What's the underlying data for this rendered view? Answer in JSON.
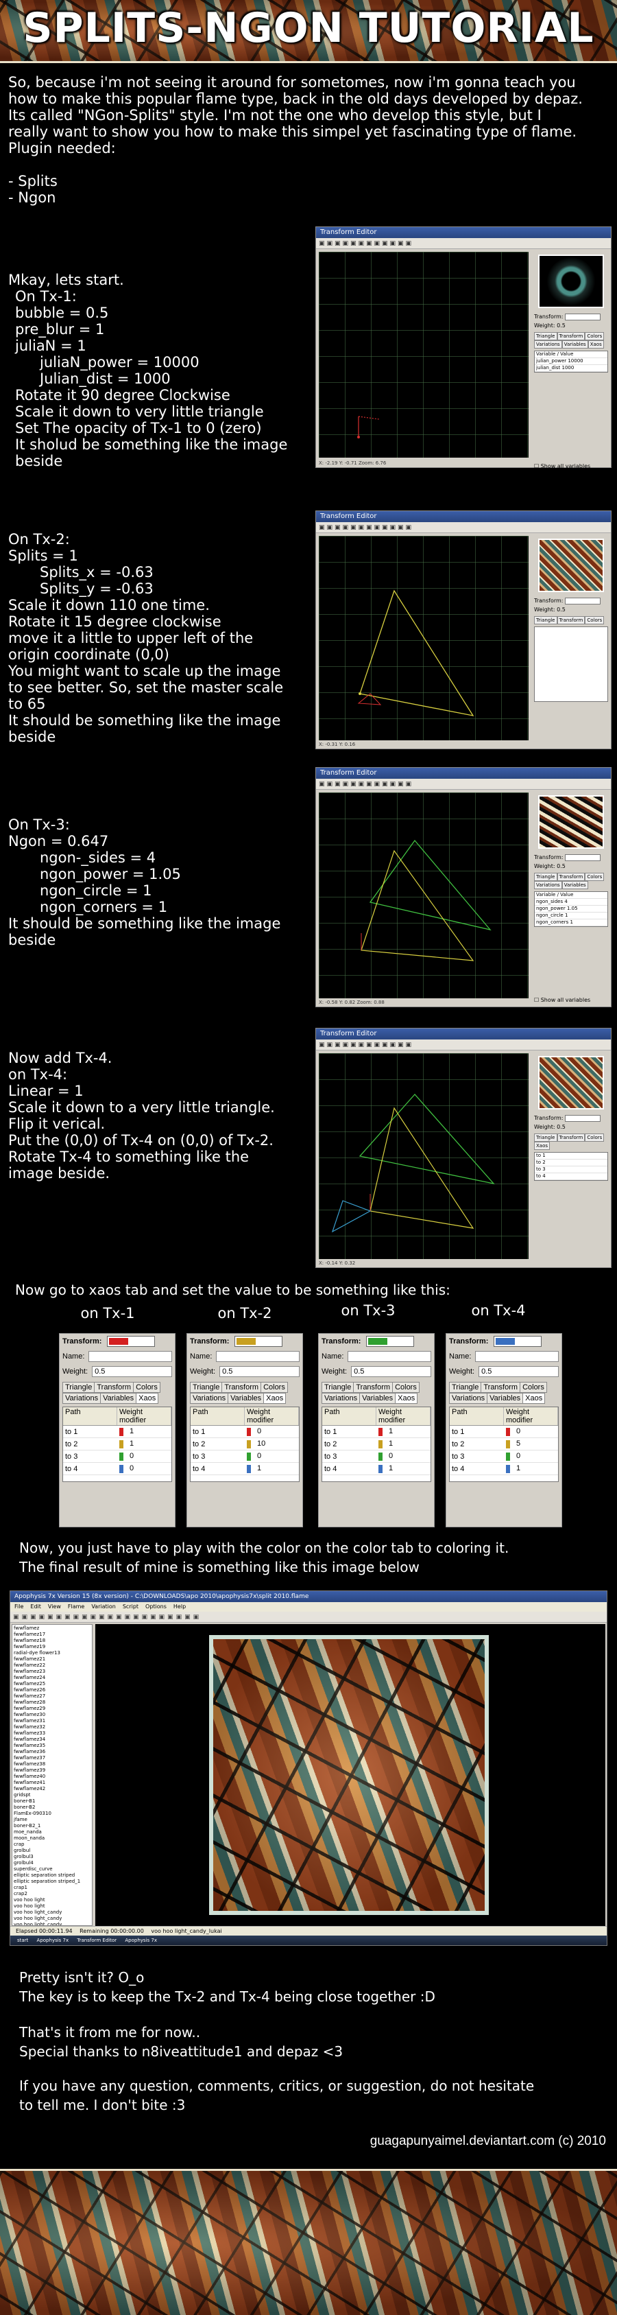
{
  "header": {
    "title": "SPLITS-NGON TUTORIAL"
  },
  "intro": {
    "line1": "So, because i'm not seeing it around for sometomes, now i'm gonna teach you",
    "line2": "how to make this popular flame type, back in the old days developed by depaz.",
    "line3": "Its called \"NGon-Splits\" style. I'm not the one who develop this style, but I",
    "line4": "really want to show you how to make this simpel yet fascinating type of flame.",
    "line5": "Plugin needed:",
    "plugin1": "- Splits",
    "plugin2": "- Ngon"
  },
  "step1": {
    "lines": [
      "Mkay, lets start.",
      "On Tx-1:",
      "bubble = 0.5",
      "pre_blur = 1",
      "juliaN = 1",
      "juliaN_power = 10000",
      "Julian_dist = 1000",
      "Rotate it 90 degree Clockwise",
      "Scale it down to very little triangle",
      "Set The opacity of Tx-1 to 0 (zero)",
      "It sholud be something like the image",
      "beside"
    ]
  },
  "step2": {
    "lines": [
      "On Tx-2:",
      "Splits = 1",
      "Splits_x = -0.63",
      "Splits_y = -0.63",
      "Scale it down 110 one time.",
      "Rotate it 15 degree clockwise",
      "move it a little to upper left of the",
      "origin coordinate (0,0)",
      "You might want to scale up the image",
      "to see better. So, set the master scale",
      "to 65",
      "It should be something like the image",
      "beside"
    ]
  },
  "step3": {
    "lines": [
      "On Tx-3:",
      "Ngon = 0.647",
      "ngon-_sides = 4",
      "ngon_power = 1.05",
      "ngon_circle = 1",
      "ngon_corners = 1",
      "It should be something like the image",
      "beside"
    ]
  },
  "step4": {
    "lines": [
      "Now add Tx-4.",
      "on Tx-4:",
      "Linear = 1",
      "Scale it down to a very little triangle.",
      "Flip it verical.",
      "Put the (0,0) of Tx-4 on (0,0) of Tx-2.",
      "Rotate Tx-4 to something like the",
      "image beside."
    ]
  },
  "editor": {
    "title": "Transform Editor",
    "transform_label": "Transform:",
    "weight_label": "Weight:",
    "weight_value": "0.5",
    "tabs": [
      "Triangle",
      "Transform",
      "Colors",
      "Variations",
      "Variables",
      "Xaos"
    ],
    "var_header": [
      "Variable",
      "Value"
    ],
    "win1_vars": [
      "julian_power  10000",
      "julian_dist  1000"
    ],
    "win3_vars": [
      "ngon_sides  4",
      "ngon_power  1.05",
      "ngon_circle  1",
      "ngon_corners  1"
    ],
    "show_all": "Show all variables",
    "status1": "X: -2.19    Y: -0.71    Zoom: 6.76",
    "status2": "X: -0.31    Y: 0.16",
    "status3": "X: -0.58    Y: 0.82    Zoom: 0.88",
    "status4": "X: -0.14    Y: 0.32"
  },
  "xaos": {
    "intro": "Now go to xaos tab and set the value to be something like this:",
    "transform_label": "Transform:",
    "name_label": "Name:",
    "weight_label": "Weight:",
    "weight_value": "0.5",
    "tabs": [
      "Triangle",
      "Transform",
      "Colors",
      "Variations",
      "Variables",
      "Xaos"
    ],
    "grid_header": [
      "Path",
      "Weight modifier"
    ],
    "panels": [
      {
        "label": "on Tx-1",
        "rows": [
          [
            "to 1",
            "1"
          ],
          [
            "to 2",
            "1"
          ],
          [
            "to 3",
            "0"
          ],
          [
            "to 4",
            "0"
          ]
        ]
      },
      {
        "label": "on Tx-2",
        "rows": [
          [
            "to 1",
            "0"
          ],
          [
            "to 2",
            "10"
          ],
          [
            "to 3",
            "0"
          ],
          [
            "to 4",
            "1"
          ]
        ]
      },
      {
        "label": "on Tx-3",
        "rows": [
          [
            "to 1",
            "1"
          ],
          [
            "to 2",
            "1"
          ],
          [
            "to 3",
            "0"
          ],
          [
            "to 4",
            "1"
          ]
        ]
      },
      {
        "label": "on Tx-4",
        "rows": [
          [
            "to 1",
            "0"
          ],
          [
            "to 2",
            "5"
          ],
          [
            "to 3",
            "0"
          ],
          [
            "to 4",
            "1"
          ]
        ]
      }
    ],
    "swatches": [
      "#d42020",
      "#c8a020",
      "#30a030",
      "#3a70c0"
    ]
  },
  "final": {
    "line1": "Now, you just have to play with the color on the color tab to coloring it.",
    "line2": "The final result of mine is something like this image below"
  },
  "apophysis": {
    "title": "Apophysis 7x Version 15 (8x version) - C:\\DOWNLOADS\\apo 2010\\apophysis7x\\split 2010.flame",
    "menu": [
      "File",
      "Edit",
      "View",
      "Flame",
      "Variation",
      "Script",
      "Options",
      "Help"
    ],
    "list": [
      "fwwflamez",
      "fwwflamez17",
      "fwwflamez18",
      "fwwflamez19",
      "radial-dye flower13",
      "fwwflamez21",
      "fwwflamez22",
      "fwwflamez23",
      "fwwflamez24",
      "fwwflamez25",
      "fwwflamez26",
      "fwwflamez27",
      "fwwflamez28",
      "fwwflamez29",
      "fwwflamez30",
      "fwwflamez31",
      "fwwflamez32",
      "fwwflamez33",
      "fwwflamez34",
      "fwwflamez35",
      "fwwflamez36",
      "fwwflamez37",
      "fwwflamez38",
      "fwwflamez39",
      "fwwflamez40",
      "fwwflamez41",
      "fwwflamez42",
      "gridspt",
      "boner-B1",
      "boner-B2",
      "FlamEx-090310",
      "jfame",
      "boner-B2_1",
      "moe_nanda",
      "moon_nanda",
      "crap",
      "grolbul",
      "grolbul3",
      "grolbul4",
      "superdisc_curve",
      "elliptic separation striped",
      "elliptic separation striped_1",
      "crap1",
      "crap2",
      "voo hoo light",
      "voo hoo light",
      "voo hoo light_candy",
      "voo hoo light_candy",
      "voo hoo light_candy",
      "split 2010"
    ],
    "status": [
      "Elapsed 00:00:11.94",
      "Remaining 00:00:00.00",
      "voo hoo light_candy_lukai"
    ],
    "taskbar": [
      "start",
      "Apophysis 7x",
      "Transform Editor",
      "Apophysis 7x"
    ]
  },
  "closing": {
    "line1": "Pretty isn't it? O_o",
    "line2": "The key is to keep the Tx-2 and Tx-4 being close together :D",
    "line3": "That's it from me for now..",
    "line4": "Special thanks to n8iveattitude1 and depaz <3",
    "line5": "If you have any question, comments, critics, or suggestion, do not hesitate",
    "line6": "to tell me. I don't bite :3"
  },
  "credit": "guagapunyaimel.deviantart.com (c) 2010"
}
